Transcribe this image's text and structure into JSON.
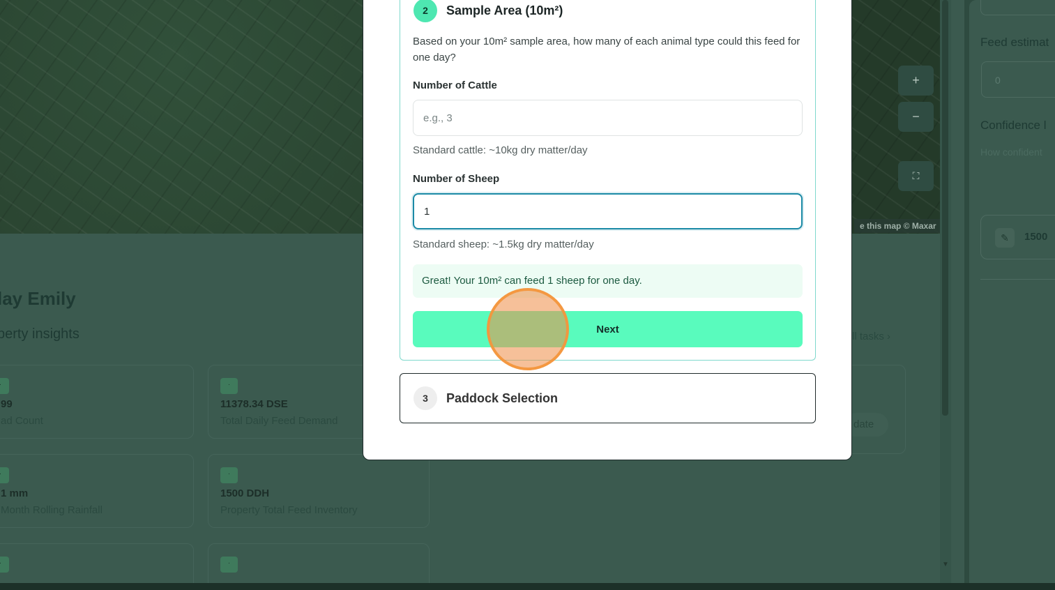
{
  "background": {
    "greeting": "lay Emily",
    "subgreeting": "perty insights",
    "tasks_link": "ll tasks",
    "map_attribution": "e this map © Maxar",
    "map_controls": {
      "zoom_in": "+",
      "zoom_out": "−",
      "fullscreen": "⛶"
    },
    "stats": [
      {
        "value": "99",
        "label": "ad Count"
      },
      {
        "value": "11378.34  DSE",
        "label": "Total Daily Feed Demand"
      },
      {
        "value": "1  mm",
        "label": "Month Rolling Rainfall"
      },
      {
        "value": "1500  DDH",
        "label": "Property Total Feed Inventory"
      }
    ],
    "task_pill": "date"
  },
  "right_panel": {
    "feed_title": "Feed estimat",
    "feed_value": "0",
    "confidence_title": "Confidence l",
    "confidence_sub": "How confident",
    "card_value": "1500 "
  },
  "modal": {
    "step2": {
      "number": "2",
      "title": "Sample Area (10m²)",
      "question": "Based on your 10m² sample area, how many of each animal type could this feed for one day?",
      "cattle_label": "Number of Cattle",
      "cattle_placeholder": "e.g., 3",
      "cattle_value": "",
      "cattle_hint": "Standard cattle: ~10kg dry matter/day",
      "sheep_label": "Number of Sheep",
      "sheep_value": "1",
      "sheep_hint": "Standard sheep: ~1.5kg dry matter/day",
      "result": "Great! Your 10m² can feed 1 sheep for one day.",
      "next_label": "Next"
    },
    "step3": {
      "number": "3",
      "title": "Paddock Selection"
    }
  },
  "colors": {
    "accent": "#59fbbd",
    "step_badge": "#4ee7b1",
    "focus_border": "#1b8aa6",
    "click_indicator": "#f3963c"
  }
}
